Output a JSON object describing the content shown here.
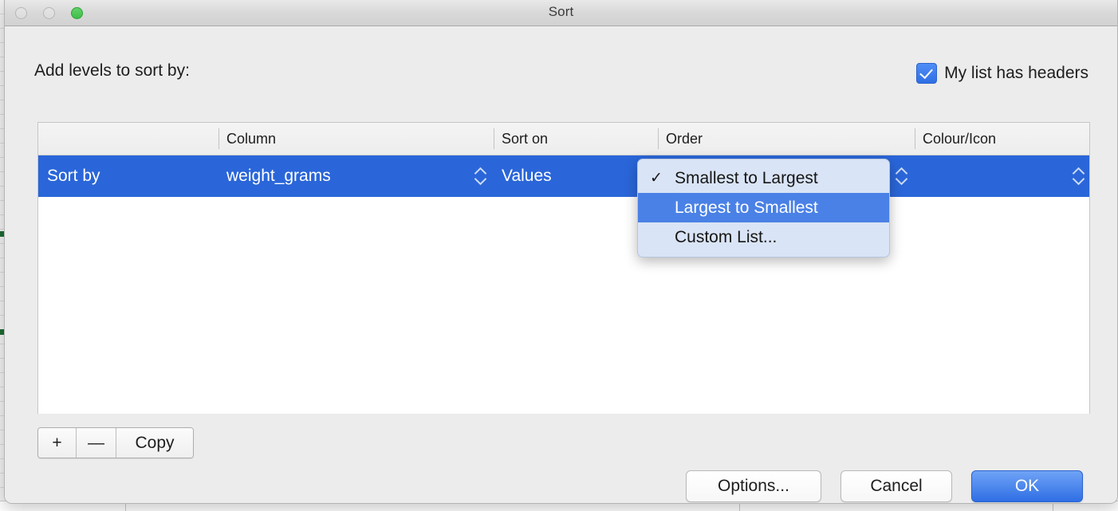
{
  "window": {
    "title": "Sort",
    "traffic_lights": [
      "close-disabled",
      "minimize-disabled",
      "zoom-green"
    ]
  },
  "header": {
    "add_levels_label": "Add levels to sort by:",
    "my_list_has_headers_label": "My list has headers",
    "my_list_has_headers_checked": true
  },
  "table": {
    "columns": [
      "",
      "Column",
      "Sort on",
      "Order",
      "Colour/Icon"
    ],
    "rows": [
      {
        "level_label": "Sort by",
        "column": "weight_grams",
        "sort_on": "Values",
        "order": "Smallest to Largest",
        "colour_icon": "",
        "selected": true
      }
    ]
  },
  "order_menu": {
    "open": true,
    "items": [
      {
        "label": "Smallest to Largest",
        "checked": true,
        "highlighted": false
      },
      {
        "label": "Largest to Smallest",
        "checked": false,
        "highlighted": true
      },
      {
        "label": "Custom List...",
        "checked": false,
        "highlighted": false
      }
    ],
    "check_glyph": "✓"
  },
  "level_buttons": {
    "add_label": "+",
    "remove_label": "—",
    "copy_label": "Copy"
  },
  "footer": {
    "options_label": "Options...",
    "cancel_label": "Cancel",
    "ok_label": "OK"
  },
  "colors": {
    "selection_blue": "#2a66d9",
    "menu_highlight_blue": "#4a81e6",
    "menu_background": "#d9e4f6",
    "default_button_blue": "#2f6fe4",
    "window_background": "#ececec",
    "green_traffic_light": "#3fbe49"
  }
}
